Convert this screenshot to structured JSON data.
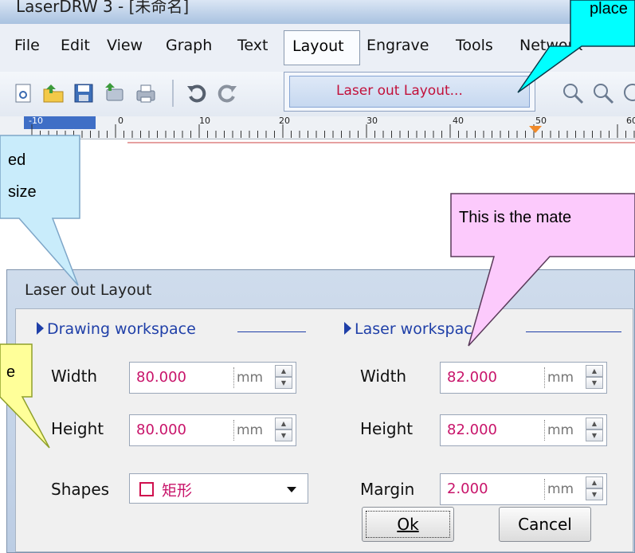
{
  "window": {
    "title": "LaserDRW 3 - [未命名]"
  },
  "menu": {
    "items": [
      "File",
      "Edit",
      "View",
      "Graph",
      "Text",
      "Layout",
      "Engrave",
      "Tools",
      "Network"
    ],
    "active": "Layout",
    "dropdown_item": "Laser out Layout..."
  },
  "ruler": {
    "labels": [
      "-10",
      "0",
      "10",
      "20",
      "30",
      "40",
      "50",
      "60"
    ]
  },
  "dialog": {
    "title": "Laser out Layout",
    "drawing": {
      "section": "Drawing workspace",
      "width_label": "Width",
      "width_value": "80.000",
      "height_label": "Height",
      "height_value": "80.000",
      "shapes_label": "Shapes",
      "shapes_value": "矩形",
      "unit": "mm"
    },
    "laser": {
      "section": "Laser workspace",
      "width_label": "Width",
      "width_value": "82.000",
      "height_label": "Height",
      "height_value": "82.000",
      "margin_label": "Margin",
      "margin_value": "2.000",
      "unit": "mm"
    },
    "ok_label": "Ok",
    "cancel_label": "Cancel"
  },
  "callouts": {
    "top_right": "place",
    "left_blue_1": "ed",
    "left_blue_2": "size",
    "pink": "This is the mate",
    "yellow": "e"
  },
  "colors": {
    "value_text": "#c8146a",
    "section_text": "#1f3fa8",
    "callout_cyan": "#00ffff",
    "callout_blue": "#c9ecfb",
    "callout_pink": "#fccafc",
    "callout_yellow": "#ffff99"
  }
}
